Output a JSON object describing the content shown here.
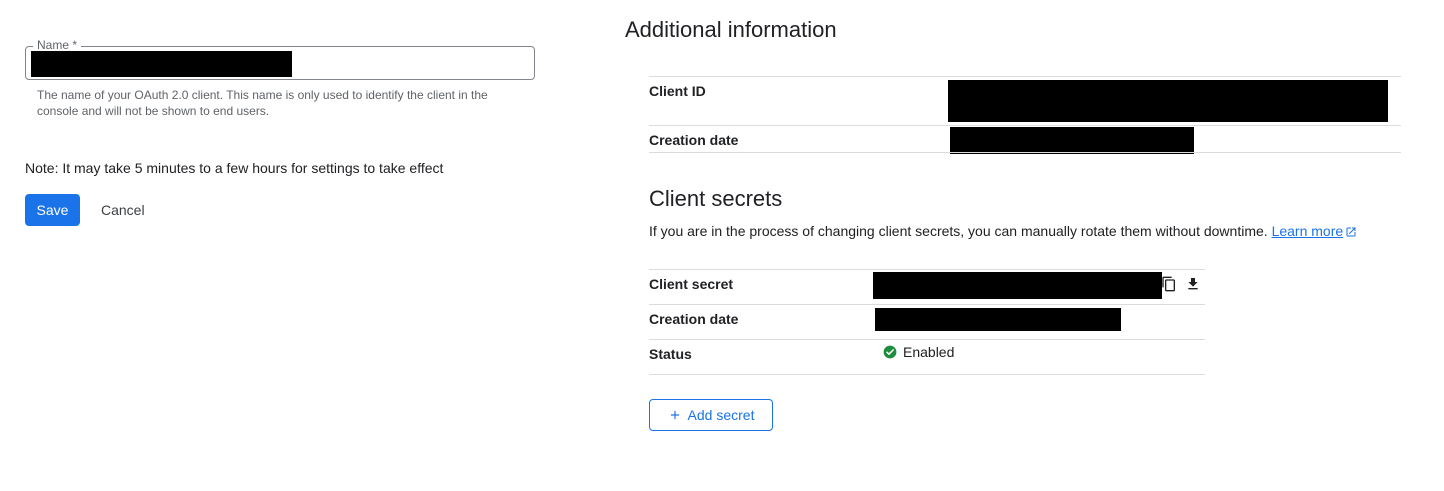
{
  "form": {
    "name_label": "Name *",
    "name_value": "",
    "name_hint": "The name of your OAuth 2.0 client. This name is only used to identify the client in the console and will not be shown to end users.",
    "note": "Note: It may take 5 minutes to a few hours for settings to take effect",
    "save_label": "Save",
    "cancel_label": "Cancel"
  },
  "additional_info": {
    "title": "Additional information",
    "client_id_label": "Client ID",
    "creation_date_label": "Creation date"
  },
  "client_secrets": {
    "title": "Client secrets",
    "description": "If you are in the process of changing client secrets, you can manually rotate them without downtime.",
    "learn_more": "Learn more",
    "secret_label": "Client secret",
    "creation_date_label": "Creation date",
    "status_label": "Status",
    "status_value": "Enabled",
    "add_secret_label": "Add secret"
  },
  "icons": {
    "copy": "copy-icon",
    "download": "download-icon",
    "status": "check-circle-icon",
    "external": "external-link-icon",
    "add": "plus-icon"
  },
  "colors": {
    "primary": "#1a73e8",
    "success": "#1e8e3e",
    "divider": "#dadce0",
    "redacted": "#000000"
  }
}
